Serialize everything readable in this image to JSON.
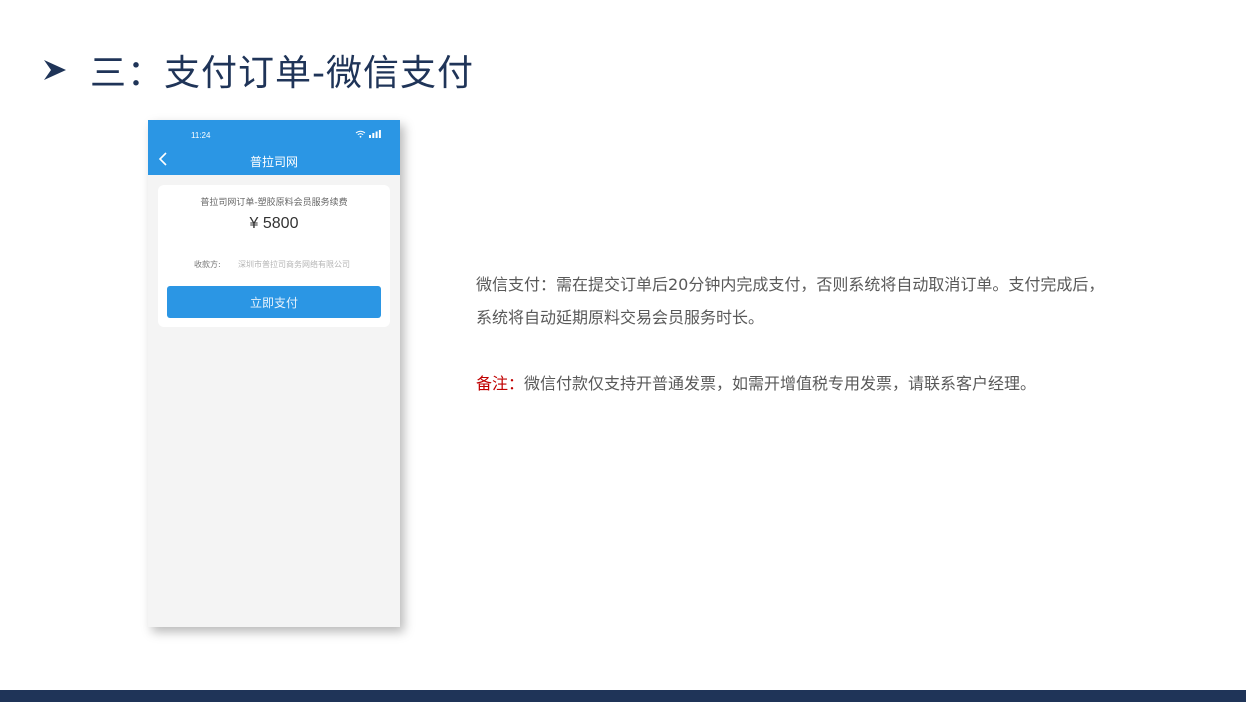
{
  "slide": {
    "title": "三：支付订单-微信支付"
  },
  "phone": {
    "status_time": "11:24",
    "nav_title": "普拉司网",
    "order": {
      "name": "普拉司网订单-塑胶原料会员服务续费",
      "amount": "¥ 5800",
      "payee_label": "收款方:",
      "payee_name": "深圳市普拉司商务网络有限公司"
    },
    "pay_button_label": "立即支付"
  },
  "description": {
    "payment": "微信支付：需在提交订单后20分钟内完成支付，否则系统将自动取消订单。支付完成后，系统将自动延期原料交易会员服务时长。",
    "note_label": "备注：",
    "note_text": "微信付款仅支持开普通发票，如需开增值税专用发票，请联系客户经理。"
  },
  "colors": {
    "title": "#1f3458",
    "phone_header": "#2b96e4",
    "note_label": "#c00000",
    "footer_bar": "#1f3458"
  },
  "icons": [
    "arrow-bullet-icon",
    "back-icon",
    "wifi-icon",
    "signal-icon"
  ]
}
